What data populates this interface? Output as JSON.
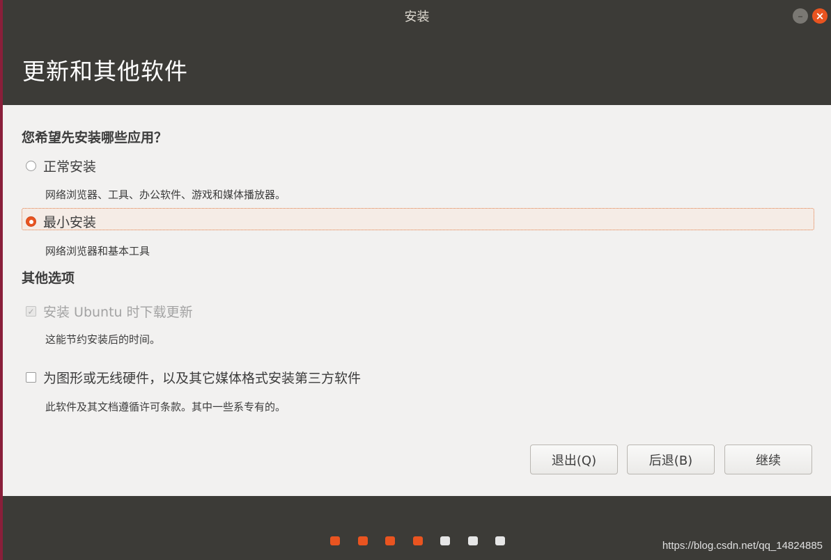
{
  "window": {
    "title": "安装",
    "minimize_glyph": "–",
    "close_glyph": "×"
  },
  "header": {
    "title": "更新和其他软件"
  },
  "question": "您希望先安装哪些应用？",
  "install_options": [
    {
      "label": "正常安装",
      "description": "网络浏览器、工具、办公软件、游戏和媒体播放器。",
      "selected": false
    },
    {
      "label": "最小安装",
      "description": "网络浏览器和基本工具",
      "selected": true
    }
  ],
  "other_options": {
    "title": "其他选项",
    "items": [
      {
        "label": "安装 Ubuntu 时下载更新",
        "description": "这能节约安装后的时间。",
        "checked": true,
        "disabled": true
      },
      {
        "label": "为图形或无线硬件，以及其它媒体格式安装第三方软件",
        "description": "此软件及其文档遵循许可条款。其中一些系专有的。",
        "checked": false,
        "disabled": false
      }
    ]
  },
  "buttons": {
    "quit": "退出(Q)",
    "back": "后退(B)",
    "continue": "继续"
  },
  "progress": {
    "total_steps": 7,
    "completed_steps": 4
  },
  "colors": {
    "accent": "#e95420",
    "header_bg": "#3c3b37",
    "dot_inactive": "#e6e6e6"
  },
  "watermark": "https://blog.csdn.net/qq_14824885"
}
